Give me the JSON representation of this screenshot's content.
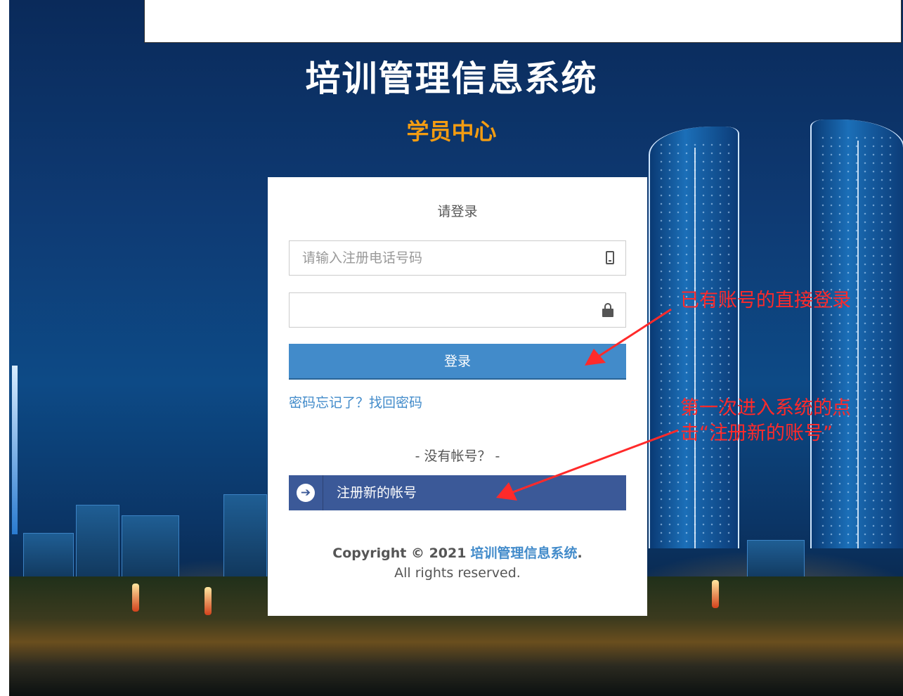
{
  "header": {
    "system_title": "培训管理信息系统",
    "center_name": "学员中心"
  },
  "login": {
    "heading": "请登录",
    "phone_placeholder": "请输入注册电话号码",
    "password_value": "",
    "login_label": "登录",
    "forgot_link": "密码忘记了？找回密码",
    "no_account": "- 没有帐号？ -",
    "register_label": "注册新的帐号"
  },
  "footer": {
    "copyright_prefix": "Copyright © 2021",
    "brand": "培训管理信息系统",
    "period": ".",
    "reserved": "All rights reserved."
  },
  "annotations": {
    "login_hint": "已有账号的直接登录",
    "register_hint": "第一次进入系统的点击“注册新的账号”"
  },
  "icons": {
    "phone": "mobile-phone-icon",
    "lock": "lock-icon",
    "register": "arrow-circle-right-icon"
  },
  "colors": {
    "primary": "#428bca",
    "register": "#3b5998",
    "subtitle": "#f39c12",
    "annotation": "#ff2a2a"
  }
}
